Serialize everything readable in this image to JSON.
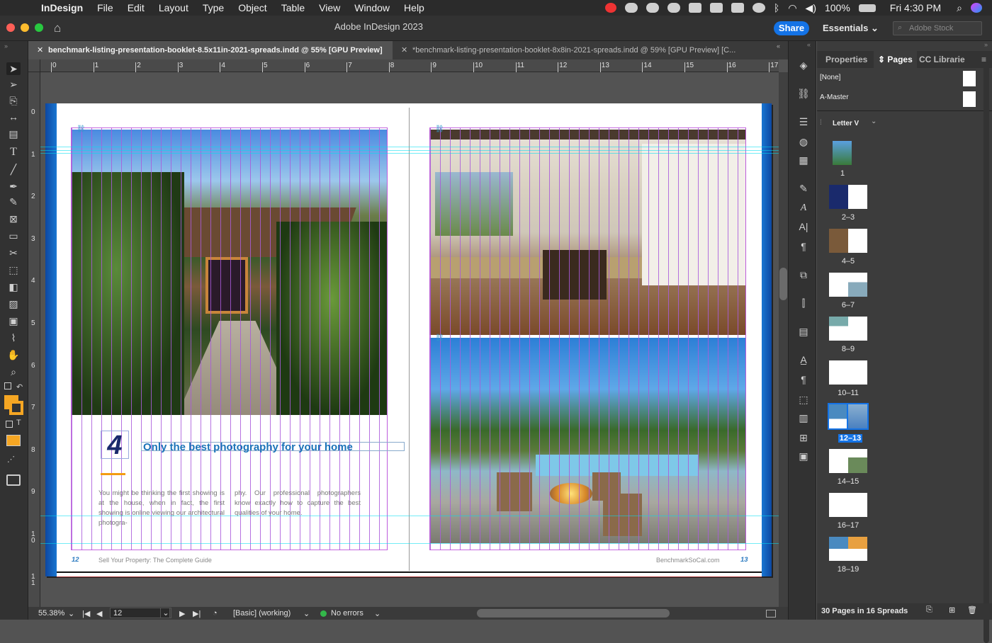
{
  "menubar": {
    "app": "InDesign",
    "items": [
      "File",
      "Edit",
      "Layout",
      "Type",
      "Object",
      "Table",
      "View",
      "Window",
      "Help"
    ],
    "battery": "100%",
    "clock": "Fri 4:30 PM"
  },
  "window": {
    "title": "Adobe InDesign 2023",
    "share": "Share",
    "workspace": "Essentials",
    "stock_placeholder": "Adobe Stock"
  },
  "tabs": [
    {
      "label": "benchmark-listing-presentation-booklet-8.5x11in-2021-spreads.indd @ 55% [GPU Preview]",
      "active": true
    },
    {
      "label": "*benchmark-listing-presentation-booklet-8x8in-2021-spreads.indd @ 59% [GPU Preview] [C...",
      "active": false
    }
  ],
  "ruler": {
    "h": [
      "0",
      "1",
      "2",
      "3",
      "4",
      "5",
      "6",
      "7",
      "8",
      "9",
      "10",
      "11",
      "12",
      "13",
      "14",
      "15",
      "16",
      "17"
    ],
    "v": [
      "0",
      "1",
      "2",
      "3",
      "4",
      "5",
      "6",
      "7",
      "8",
      "9",
      "1\n0",
      "1\n1"
    ]
  },
  "page": {
    "number_badge": "4",
    "headline": "Only the best photography for your home",
    "body_col1": "You might be thinking the first showing is at the house, when in fact, the first showing is online viewing our architectural photogra-",
    "body_col2": "phy. Our professional photographers know exactly how to capture the best qualities of your home.",
    "footer_left": "Sell Your Property: The Complete Guide",
    "footer_right": "BenchmarkSoCal.com",
    "page_left": "12",
    "page_right": "13"
  },
  "status": {
    "zoom": "55.38%",
    "page": "12",
    "style": "[Basic] (working)",
    "errors": "No errors"
  },
  "panel": {
    "tabs": [
      "Properties",
      "Pages",
      "CC Librarie"
    ],
    "active_tab": "Pages",
    "masters": [
      "[None]",
      "A-Master"
    ],
    "size_label": "Letter V",
    "spreads": [
      "1",
      "2–3",
      "4–5",
      "6–7",
      "8–9",
      "10–11",
      "12–13",
      "14–15",
      "16–17",
      "18–19"
    ],
    "selected_spread": "12–13",
    "footer": "30 Pages in 16 Spreads"
  },
  "colors": {
    "accent": "#1473e6",
    "headline": "#1a73b8",
    "rule": "#f39c12"
  }
}
